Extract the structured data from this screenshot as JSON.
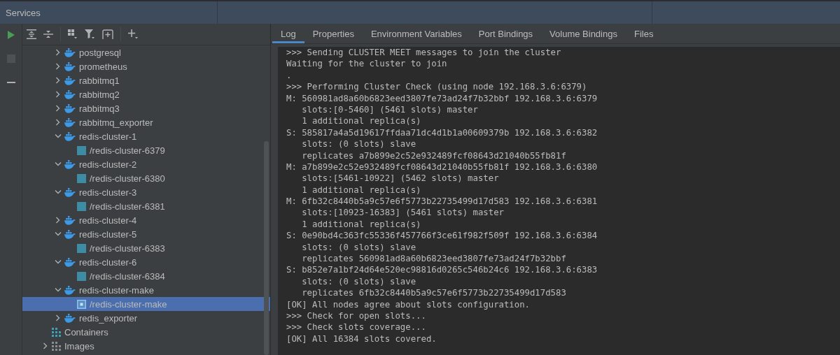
{
  "window": {
    "title": "Services"
  },
  "toolbar": {
    "side_buttons": [
      {
        "kind": "run",
        "disabled": false
      },
      {
        "kind": "stop",
        "disabled": true
      },
      {
        "kind": "minus",
        "disabled": false
      }
    ],
    "tree_buttons": [
      {
        "kind": "expand-all"
      },
      {
        "kind": "collapse-all"
      },
      {
        "kind": "group"
      },
      {
        "kind": "filter"
      },
      {
        "kind": "new-tab"
      },
      {
        "kind": "add"
      }
    ]
  },
  "tree": {
    "items": [
      {
        "label": "postgresql",
        "kind": "service",
        "expanded": false
      },
      {
        "label": "prometheus",
        "kind": "service",
        "expanded": false
      },
      {
        "label": "rabbitmq1",
        "kind": "service",
        "expanded": false
      },
      {
        "label": "rabbitmq2",
        "kind": "service",
        "expanded": false
      },
      {
        "label": "rabbitmq3",
        "kind": "service",
        "expanded": false
      },
      {
        "label": "rabbitmq_exporter",
        "kind": "service",
        "expanded": false
      },
      {
        "label": "redis-cluster-1",
        "kind": "service",
        "expanded": true,
        "children": [
          {
            "label": "/redis-cluster-6379",
            "kind": "container",
            "selected": false
          }
        ]
      },
      {
        "label": "redis-cluster-2",
        "kind": "service",
        "expanded": true,
        "children": [
          {
            "label": "/redis-cluster-6380",
            "kind": "container",
            "selected": false
          }
        ]
      },
      {
        "label": "redis-cluster-3",
        "kind": "service",
        "expanded": true,
        "children": [
          {
            "label": "/redis-cluster-6381",
            "kind": "container",
            "selected": false
          }
        ]
      },
      {
        "label": "redis-cluster-4",
        "kind": "service",
        "expanded": false
      },
      {
        "label": "redis-cluster-5",
        "kind": "service",
        "expanded": true,
        "children": [
          {
            "label": "/redis-cluster-6383",
            "kind": "container",
            "selected": false
          }
        ]
      },
      {
        "label": "redis-cluster-6",
        "kind": "service",
        "expanded": true,
        "children": [
          {
            "label": "/redis-cluster-6384",
            "kind": "container",
            "selected": false
          }
        ]
      },
      {
        "label": "redis-cluster-make",
        "kind": "service",
        "expanded": true,
        "children": [
          {
            "label": "/redis-cluster-make",
            "kind": "container",
            "selected": true
          }
        ]
      },
      {
        "label": "redis_exporter",
        "kind": "service",
        "expanded": false
      }
    ],
    "root_items": [
      {
        "label": "Containers",
        "kind": "containers"
      },
      {
        "label": "Images",
        "kind": "images",
        "expanded": false
      }
    ]
  },
  "tabs": [
    {
      "label": "Log",
      "selected": true
    },
    {
      "label": "Properties",
      "selected": false
    },
    {
      "label": "Environment Variables",
      "selected": false
    },
    {
      "label": "Port Bindings",
      "selected": false
    },
    {
      "label": "Volume Bindings",
      "selected": false
    },
    {
      "label": "Files",
      "selected": false
    }
  ],
  "log": {
    "lines": [
      ">>> Sending CLUSTER MEET messages to join the cluster",
      "Waiting for the cluster to join",
      ".",
      ">>> Performing Cluster Check (using node 192.168.3.6:6379)",
      "M: 560981ad8a60b6823eed3807fe73ad24f7b32bbf 192.168.3.6:6379",
      "   slots:[0-5460] (5461 slots) master",
      "   1 additional replica(s)",
      "S: 585817a4a5d19617ffdaa71dc4d1b1a00609379b 192.168.3.6:6382",
      "   slots: (0 slots) slave",
      "   replicates a7b899e2c52e932489fcf08643d21040b55fb81f",
      "M: a7b899e2c52e932489fcf08643d21040b55fb81f 192.168.3.6:6380",
      "   slots:[5461-10922] (5462 slots) master",
      "   1 additional replica(s)",
      "M: 6fb32c8440b5a9c57e6f5773b22735499d17d583 192.168.3.6:6381",
      "   slots:[10923-16383] (5461 slots) master",
      "   1 additional replica(s)",
      "S: 0e90bd4c363fc55336f457766f3ce61f982f509f 192.168.3.6:6384",
      "   slots: (0 slots) slave",
      "   replicates 560981ad8a60b6823eed3807fe73ad24f7b32bbf",
      "S: b852e7a1bf24d64e520ec98816d0265c546b24c6 192.168.3.6:6383",
      "   slots: (0 slots) slave",
      "   replicates 6fb32c8440b5a9c57e6f5773b22735499d17d583",
      "[OK] All nodes agree about slots configuration.",
      ">>> Check for open slots...",
      ">>> Check slots coverage...",
      "[OK] All 16384 slots covered."
    ]
  }
}
